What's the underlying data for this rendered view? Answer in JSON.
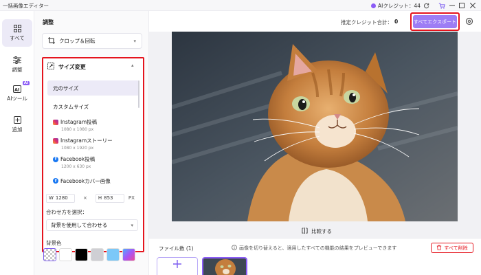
{
  "app": {
    "title": "一括画像エディター"
  },
  "titlebar": {
    "credit_label": "AIクレジット：44"
  },
  "rail": {
    "items": [
      {
        "label": "すべて",
        "icon": "grid-icon"
      },
      {
        "label": "調整",
        "icon": "sliders-icon"
      },
      {
        "label": "AIツール",
        "icon": "ai-icon",
        "badge": "AI"
      },
      {
        "label": "追加",
        "icon": "plus-square-icon"
      }
    ]
  },
  "panel": {
    "heading": "調整",
    "crop_label": "クロップ＆回転",
    "resize": {
      "label": "サイズ変更",
      "options": [
        {
          "name": "元のサイズ",
          "size": ""
        },
        {
          "name": "カスタムサイズ",
          "size": ""
        },
        {
          "name": "Instagram投稿",
          "size": "1080 x 1080 px"
        },
        {
          "name": "Instagramストーリー",
          "size": "1080 x 1920 px"
        },
        {
          "name": "Facebook投稿",
          "size": "1200 x 630 px"
        },
        {
          "name": "Facebookカバー画像",
          "size": ""
        }
      ],
      "width_label": "W",
      "width_value": "1280",
      "times": "×",
      "height_label": "H",
      "height_value": "853",
      "unit": "PX",
      "fit_label": "合わせ方を選択：",
      "fit_value": "背景を使用して合わせる",
      "bg_color_label": "背景色"
    },
    "swatch_colors": [
      "transparent",
      "#ffffff",
      "#000000",
      "#cfcfd4",
      "#7cc8f8",
      "gradient"
    ]
  },
  "topbar": {
    "estimate_label": "推定クレジット合計：",
    "estimate_value": "0",
    "export_label": "すべてエクスポート"
  },
  "compare_label": "比較する",
  "bottom": {
    "file_count_label": "ファイル数 (1)",
    "hint": "画像を切り替えると、適用したすべての機能の結果をプレビューできます",
    "delete_all_label": "すべて削除"
  },
  "colors": {
    "accent": "#8b5cf6",
    "highlight": "#e5141d",
    "export": "#9d7df5"
  }
}
